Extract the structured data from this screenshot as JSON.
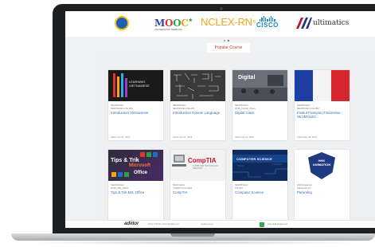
{
  "header": {
    "logos": [
      {
        "name": "kemdikbud-logo"
      },
      {
        "name": "mooc-logo",
        "text_parts": [
          "M",
          "O",
          "O",
          "C"
        ],
        "suffix": "★",
        "subtitle": "UNIVERSITAS TERBUKA"
      },
      {
        "name": "nclex-logo",
        "text": "NCLEX-RN",
        "mark": "®"
      },
      {
        "name": "cisco-logo",
        "text": "CISCO"
      },
      {
        "name": "multimatics-logo",
        "text": "ultimatics"
      }
    ],
    "carousel_dots": 2,
    "active_dot": 1
  },
  "section": {
    "tab_label": "Popular Course"
  },
  "courses": [
    {
      "code1": "SEAMOLEC",
      "code2": "SEAMOLEC-CE-001",
      "title": "Introduction Vietnamese",
      "meta": "Starts Jan 01, 2016",
      "thumb_text": "LEARNING VIETNAMESE"
    },
    {
      "code1": "SEAMOLEC",
      "code2": "SEAMOLEC-KE-001",
      "title": "Introduction Korean Language",
      "meta": "Starts Jan 01, 2016"
    },
    {
      "code1": "SEAMOLEC",
      "code2": "2016_Digital_Class",
      "title": "Digital Class",
      "meta": "Starts Apr 19, 2016",
      "thumb_text": "Digital"
    },
    {
      "code1": "SEAMOLEC",
      "code2": "SEAMOLEC-CE-002",
      "title": "Institut Français d'Indonésie - SEAMOLEC",
      "meta": "Starts May 04, 2016"
    },
    {
      "code1": "SEAMOLEC",
      "code2": "2016_MS_Office",
      "title": "Tips & Trik MS. Office",
      "thumb_lines": [
        "Tips & Trik",
        "Microsoft",
        "Office"
      ]
    },
    {
      "code1": "Multimatics",
      "code2": "COMPTIA-01-002",
      "title": "CompTIA",
      "thumb_text": "CompTIA",
      "thumb_sub": "COMPUTER TECHNOLOGY INDUSTRY"
    },
    {
      "code1": "SEAMOLEC",
      "code2": "CS-001",
      "title": "Computer Science",
      "thumb_text": "COMPUTER SCIENCE"
    },
    {
      "code1": "HHKAcademy",
      "code2": "HHKA-01-01",
      "title": "Parenting",
      "thumb_lines": [
        "HHK",
        "ANIMATION"
      ]
    }
  ],
  "footer": {
    "brand": "adidor",
    "contact": "(021) 2311922   admin@adidor.com",
    "link": "Ajukan kursus",
    "badge_text": "Aims & Entertainment"
  },
  "colors": {
    "accent": "#c0392b",
    "link": "#2f6eb5",
    "page_bg": "#eef0f2"
  }
}
